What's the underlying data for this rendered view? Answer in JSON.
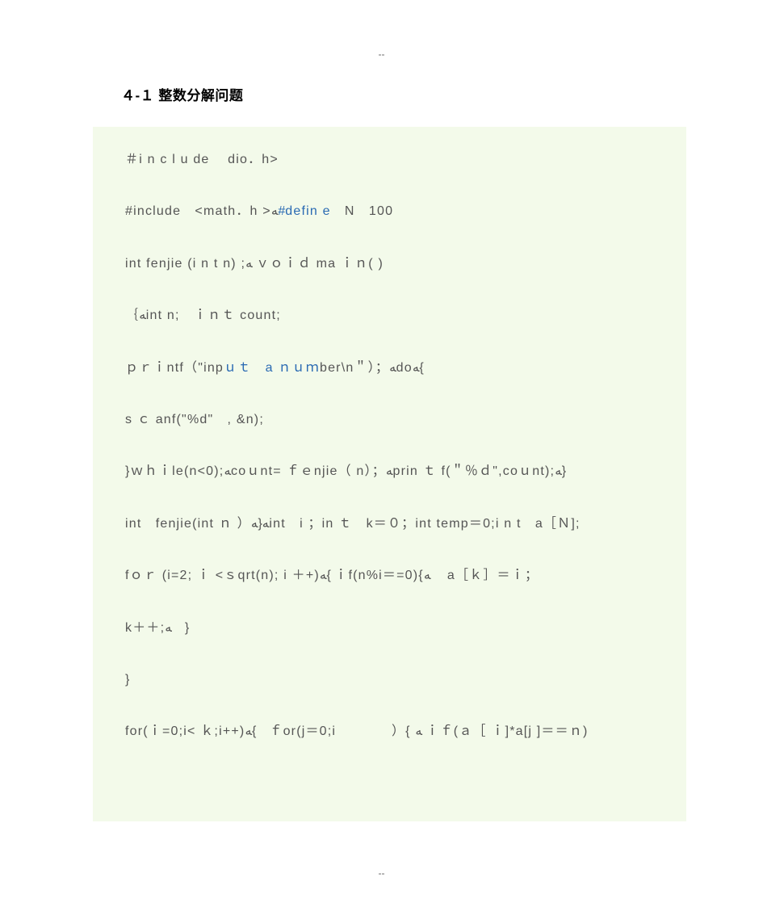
{
  "topDash": "--",
  "bottomDash": "--",
  "heading": "４-１ 整数分解问题",
  "code": {
    "line1_a": "＃i n c l u de ",
    "line1_b": "dio．h>",
    "line2_a": "#include　<math．h >",
    "line2_arrow": "ﻪ",
    "line2_kw": "#defin e",
    "line2_b": "　N　100",
    "line3": "int fenjie (i n t n) ;ﻪ ｖｏｉｄ ma ｉｎ( )",
    "line4": "｛ﻪint n;　ｉｎｔ count;",
    "line5_a": "ｐｒｉntf（\"inp",
    "line5_kw": "ｕｔ　a ｎｕｍ",
    "line5_b": "ber\\n＂）；ﻪdoﻪ{",
    "line6": "s ｃ anf(\"%d\"　,  &n);",
    "line7": "}ｗｈｉle(n<0);ﻪcoｕnt= ｆｅnjie（ n）；ﻪprin ｔ f(＂％ｄ\",coｕnt);ﻪ}",
    "line8": "int　fenjie(int ｎ ）ﻪ{ﻪint　i ；in ｔ　k＝０；int  temp＝0;i n t　a［Ｎ];",
    "line9": "fｏｒ (i=2; ｉ <ｓqrt(n); i ＋+)ﻪ{ ｉf(n%i＝=0){ﻪ　 a［ｋ］＝ｉ；",
    "line10": "k＋＋;ﻪ　}",
    "line11": "}",
    "line12": "for(ｉ=0;i< ｋ;i++)ﻪ{　ｆor(j＝0;i　　　　）{ ﻪ ｉｆ(ａ［ ｉ]*a[j ]＝＝ｎ)"
  }
}
